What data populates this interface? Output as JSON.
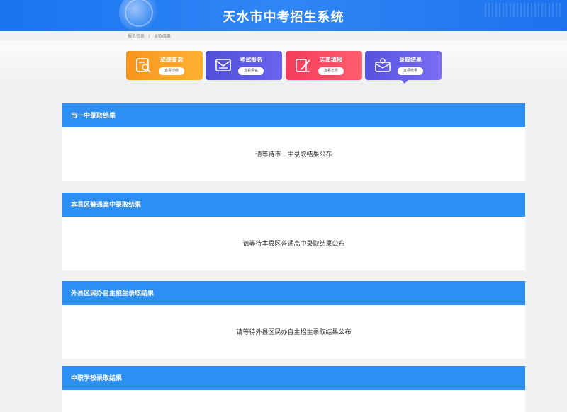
{
  "header": {
    "title": "天水市中考招生系统"
  },
  "breadcrumb": {
    "home": "报名信息",
    "separator": "/",
    "current": "录取结果"
  },
  "nav": [
    {
      "label": "成绩查询",
      "button": "查看成绩",
      "icon": "score-search-icon",
      "color": "#f7941d"
    },
    {
      "label": "考试报名",
      "button": "查看报名",
      "icon": "mail-icon",
      "color": "#4f4fd8"
    },
    {
      "label": "志愿填报",
      "button": "查看志愿",
      "icon": "pen-icon",
      "color": "#f33b5a"
    },
    {
      "label": "录取结果",
      "button": "查看结果",
      "icon": "admission-icon",
      "color": "#5651dd",
      "active": true
    }
  ],
  "sections": [
    {
      "title": "市一中录取结果",
      "message": "请等待市一中录取结果公布"
    },
    {
      "title": "本县区普通高中录取结果",
      "message": "请等待本县区普通高中录取结果公布"
    },
    {
      "title": "外县区民办自主招生录取结果",
      "message": "请等待外县区民办自主招生录取结果公布"
    },
    {
      "title": "中职学校录取结果",
      "message": ""
    }
  ]
}
